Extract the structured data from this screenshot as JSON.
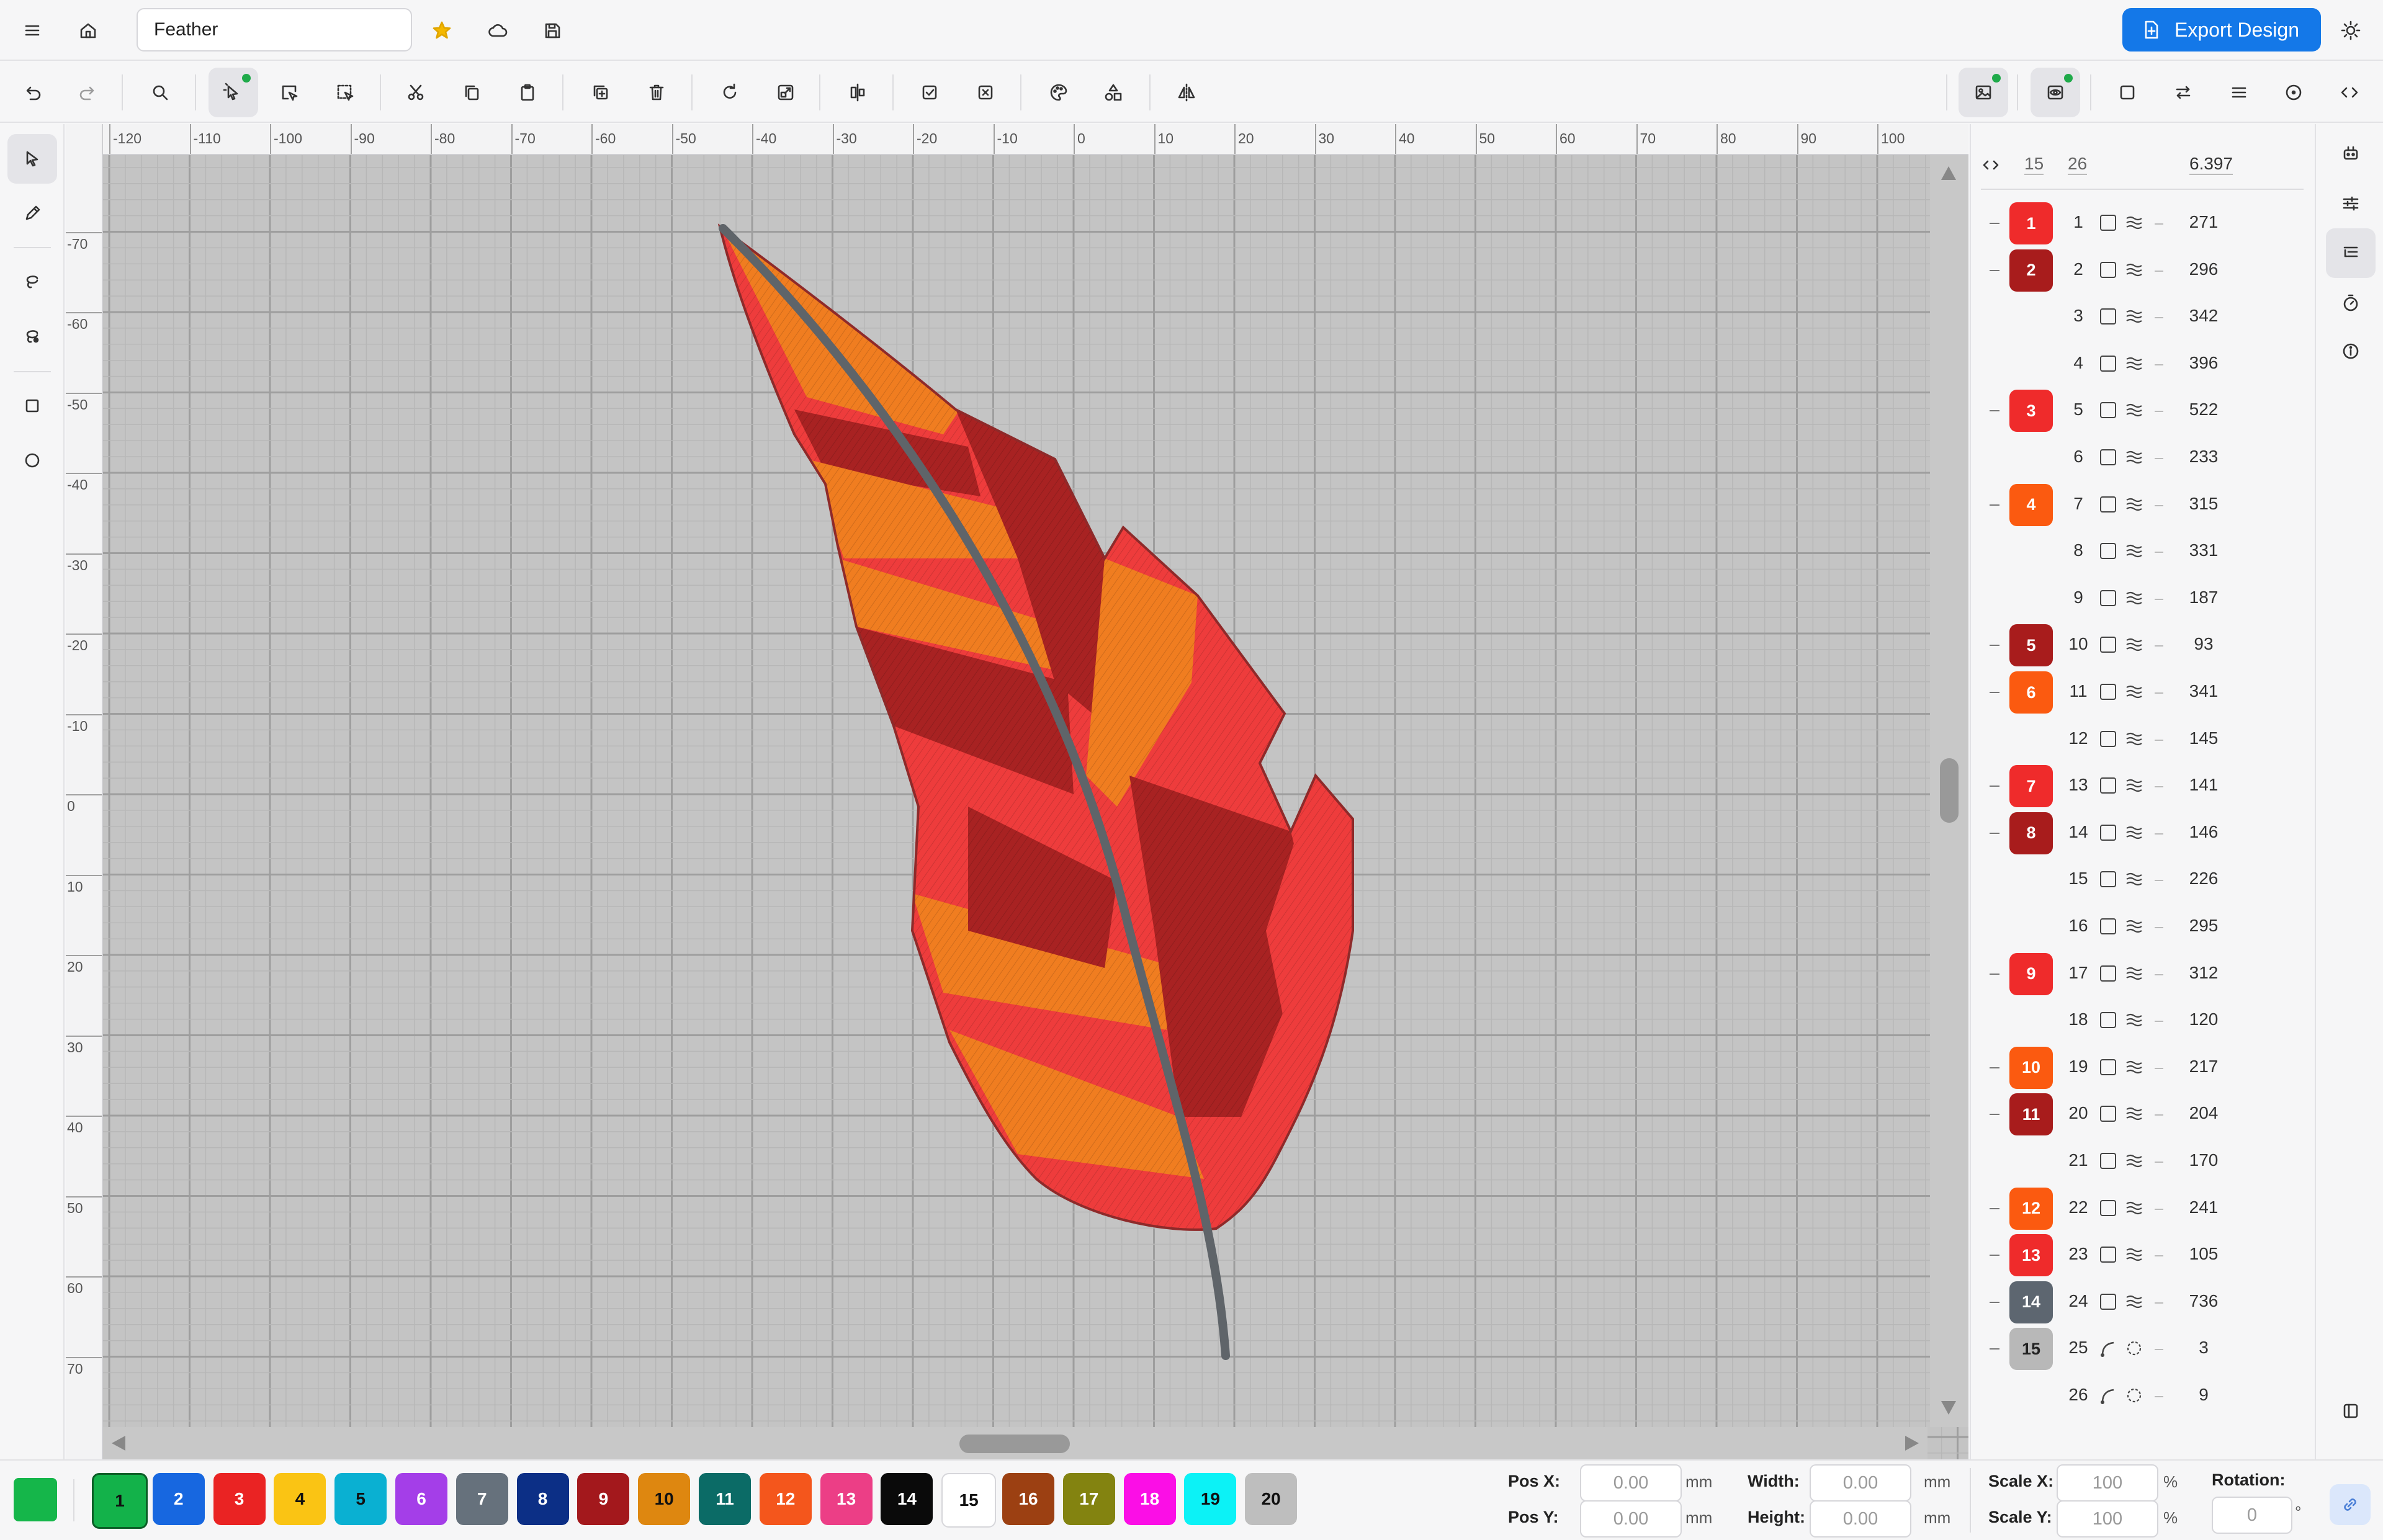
{
  "document": {
    "title": "Feather"
  },
  "header": {
    "export_label": "Export Design"
  },
  "ruler": {
    "x_ticks": [
      "-120",
      "-110",
      "-100",
      "-90",
      "-80",
      "-70",
      "-60",
      "-50",
      "-40",
      "-30",
      "-20",
      "-10",
      "0",
      "10",
      "20",
      "30",
      "40",
      "50",
      "60",
      "70",
      "80",
      "90",
      "100"
    ],
    "y_ticks": [
      "-70",
      "-60",
      "-50",
      "-40",
      "-30",
      "-20",
      "-10",
      "0",
      "10",
      "20",
      "30",
      "40",
      "50",
      "60",
      "70"
    ]
  },
  "panel": {
    "header": {
      "left": "15",
      "right": "26",
      "value": "6.397"
    },
    "rows": [
      {
        "badge": "1",
        "color": "#ef2b2b",
        "id": "1",
        "count": "271",
        "type": "fill"
      },
      {
        "badge": "2",
        "color": "#a81c1c",
        "id": "2",
        "count": "296",
        "type": "fill"
      },
      {
        "badge": "",
        "color": "",
        "id": "3",
        "count": "342",
        "type": "fill"
      },
      {
        "badge": "",
        "color": "",
        "id": "4",
        "count": "396",
        "type": "fill"
      },
      {
        "badge": "3",
        "color": "#ef2b2b",
        "id": "5",
        "count": "522",
        "type": "fill"
      },
      {
        "badge": "",
        "color": "",
        "id": "6",
        "count": "233",
        "type": "fill"
      },
      {
        "badge": "4",
        "color": "#fb5a10",
        "id": "7",
        "count": "315",
        "type": "fill"
      },
      {
        "badge": "",
        "color": "",
        "id": "8",
        "count": "331",
        "type": "fill"
      },
      {
        "badge": "",
        "color": "",
        "id": "9",
        "count": "187",
        "type": "fill"
      },
      {
        "badge": "5",
        "color": "#a81c1c",
        "id": "10",
        "count": "93",
        "type": "fill"
      },
      {
        "badge": "6",
        "color": "#fb5a10",
        "id": "11",
        "count": "341",
        "type": "fill"
      },
      {
        "badge": "",
        "color": "",
        "id": "12",
        "count": "145",
        "type": "fill"
      },
      {
        "badge": "7",
        "color": "#ef2b2b",
        "id": "13",
        "count": "141",
        "type": "fill"
      },
      {
        "badge": "8",
        "color": "#a81c1c",
        "id": "14",
        "count": "146",
        "type": "fill"
      },
      {
        "badge": "",
        "color": "",
        "id": "15",
        "count": "226",
        "type": "fill"
      },
      {
        "badge": "",
        "color": "",
        "id": "16",
        "count": "295",
        "type": "fill"
      },
      {
        "badge": "9",
        "color": "#ef2b2b",
        "id": "17",
        "count": "312",
        "type": "fill"
      },
      {
        "badge": "",
        "color": "",
        "id": "18",
        "count": "120",
        "type": "fill"
      },
      {
        "badge": "10",
        "color": "#fb5a10",
        "id": "19",
        "count": "217",
        "type": "fill"
      },
      {
        "badge": "11",
        "color": "#a81c1c",
        "id": "20",
        "count": "204",
        "type": "fill"
      },
      {
        "badge": "",
        "color": "",
        "id": "21",
        "count": "170",
        "type": "fill"
      },
      {
        "badge": "12",
        "color": "#fb5a10",
        "id": "22",
        "count": "241",
        "type": "fill"
      },
      {
        "badge": "13",
        "color": "#ef2b2b",
        "id": "23",
        "count": "105",
        "type": "fill"
      },
      {
        "badge": "14",
        "color": "#5d6670",
        "id": "24",
        "count": "736",
        "type": "fill"
      },
      {
        "badge": "15",
        "color": "#b8b8b8",
        "id": "25",
        "count": "3",
        "type": "run"
      },
      {
        "badge": "",
        "color": "",
        "id": "26",
        "count": "9",
        "type": "run"
      }
    ]
  },
  "palette": {
    "current_color": "#15b64a",
    "swatches": [
      {
        "label": "1",
        "color": "#13b24a",
        "text": "#111"
      },
      {
        "label": "2",
        "color": "#1767e0",
        "text": "#fff"
      },
      {
        "label": "3",
        "color": "#ea2323",
        "text": "#fff"
      },
      {
        "label": "4",
        "color": "#fac414",
        "text": "#111"
      },
      {
        "label": "5",
        "color": "#0ab0d2",
        "text": "#111"
      },
      {
        "label": "6",
        "color": "#a43ee8",
        "text": "#fff"
      },
      {
        "label": "7",
        "color": "#66717c",
        "text": "#fff"
      },
      {
        "label": "8",
        "color": "#0c2f86",
        "text": "#fff"
      },
      {
        "label": "9",
        "color": "#a3181c",
        "text": "#fff"
      },
      {
        "label": "10",
        "color": "#de8710",
        "text": "#111"
      },
      {
        "label": "11",
        "color": "#0b6b66",
        "text": "#fff"
      },
      {
        "label": "12",
        "color": "#f4561c",
        "text": "#fff"
      },
      {
        "label": "13",
        "color": "#ec3e86",
        "text": "#fff"
      },
      {
        "label": "14",
        "color": "#0a0a0a",
        "text": "#fff"
      },
      {
        "label": "15",
        "color": "#ffffff",
        "text": "#111"
      },
      {
        "label": "16",
        "color": "#9c4012",
        "text": "#fff"
      },
      {
        "label": "17",
        "color": "#838310",
        "text": "#fff"
      },
      {
        "label": "18",
        "color": "#fb0ee6",
        "text": "#fff"
      },
      {
        "label": "19",
        "color": "#0cf2f6",
        "text": "#111"
      },
      {
        "label": "20",
        "color": "#bebebe",
        "text": "#111"
      }
    ]
  },
  "transform": {
    "pos_x_label": "Pos X:",
    "pos_x_value": "0.00",
    "pos_x_unit": "mm",
    "pos_y_label": "Pos Y:",
    "pos_y_value": "0.00",
    "pos_y_unit": "mm",
    "width_label": "Width:",
    "width_value": "0.00",
    "width_unit": "mm",
    "height_label": "Height:",
    "height_value": "0.00",
    "height_unit": "mm",
    "scale_x_label": "Scale X:",
    "scale_x_value": "100",
    "scale_x_unit": "%",
    "scale_y_label": "Scale Y:",
    "scale_y_value": "100",
    "scale_y_unit": "%",
    "rotation_label": "Rotation:",
    "rotation_value": "0",
    "rotation_unit": "°"
  }
}
